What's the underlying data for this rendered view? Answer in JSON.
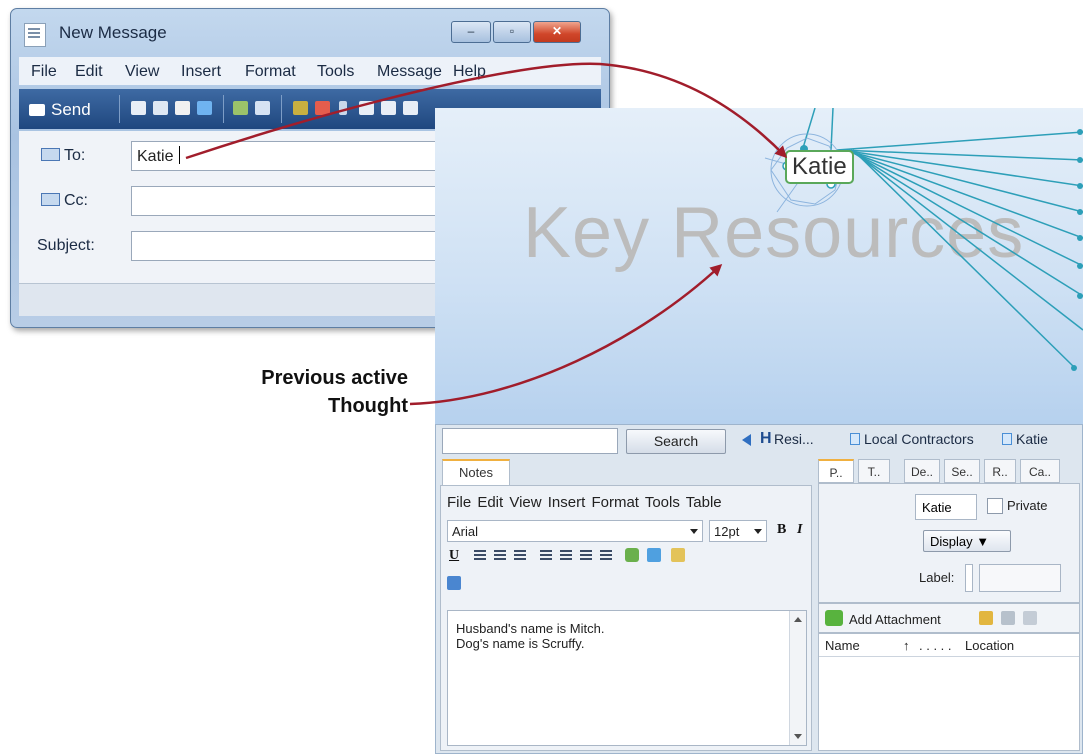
{
  "outlook": {
    "title": "New Message",
    "window_buttons": {
      "minimize": "–",
      "maximize": "▫",
      "close": "✕"
    },
    "menu": [
      "File",
      "Edit",
      "View",
      "Insert",
      "Format",
      "Tools",
      "Message",
      "Help"
    ],
    "toolbar": {
      "send_label": "Send"
    },
    "to_label": "To:",
    "cc_label": "Cc:",
    "subject_label": "Subject:",
    "to_value": "Katie",
    "cc_value": "",
    "subject_value": ""
  },
  "brain": {
    "watermark": "Key Resources",
    "active_node": "Katie",
    "search_button": "Search",
    "breadcrumbs": [
      "Resi...",
      "Local Contractors",
      "Katie"
    ],
    "notes": {
      "tab_label": "Notes",
      "menu": "File Edit View Insert Format Tools Table",
      "font": "Arial",
      "size": "12pt",
      "bold": "B",
      "italic": "I",
      "underline": "U",
      "lines": [
        "Husband's name is Mitch.",
        "Dog's name is Scruffy."
      ]
    },
    "properties": {
      "tabs": [
        "P..",
        "T..",
        "De..",
        "Se..",
        "R..",
        "Ca.."
      ],
      "name_value": "Katie",
      "private_label": "Private",
      "display_label": "Display ▼",
      "label_label": "Label:",
      "add_attachment": "Add Attachment",
      "columns": [
        "Name",
        "↑",
        ". . . . .",
        "Location"
      ]
    }
  },
  "annotation": {
    "line1": "Previous active",
    "line2": "Thought"
  },
  "colors": {
    "arrow": "#a11d2b",
    "link_lines": "#2d9fb8",
    "canvas_top": "#e5eff9",
    "canvas_bottom": "#b6d1ee"
  }
}
